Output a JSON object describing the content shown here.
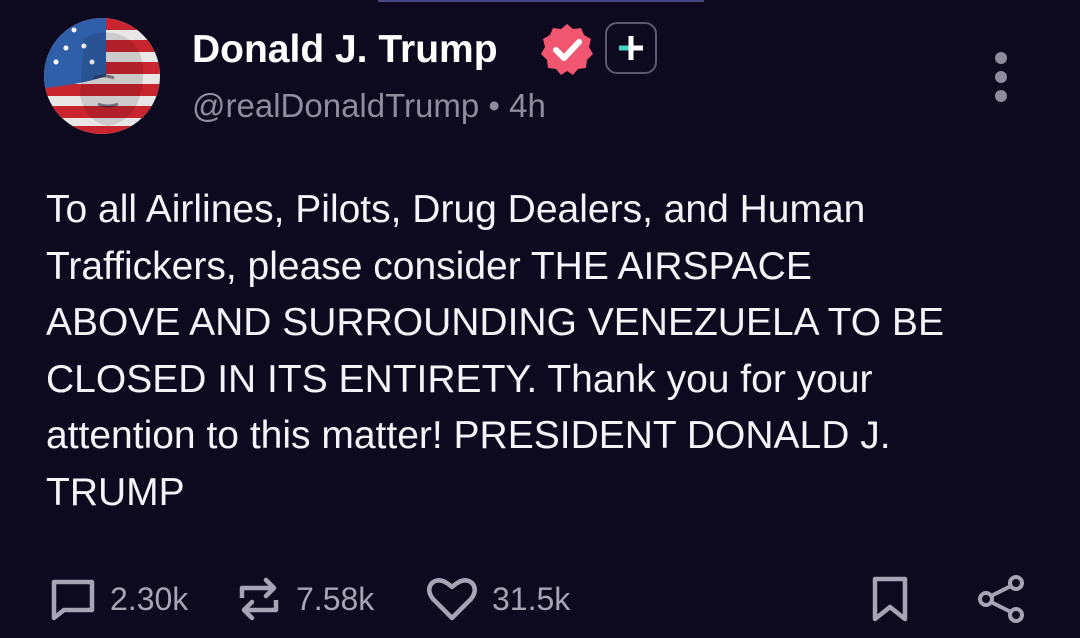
{
  "author": {
    "display_name": "Donald J. Trump",
    "handle": "@realDonaldTrump",
    "separator": "•",
    "time_ago": "4h",
    "avatar_icon": "flag-portrait-avatar",
    "verified_icon": "verified-badge-icon",
    "plus_icon": "plus-badge-icon"
  },
  "post": {
    "lines": [
      "To all Airlines, Pilots, Drug Dealers, and Human",
      "Traffickers, please consider THE AIRSPACE",
      "ABOVE AND SURROUNDING VENEZUELA TO BE",
      "CLOSED IN ITS ENTIRETY. Thank you for your",
      "attention to this matter! PRESIDENT DONALD J.",
      "TRUMP"
    ]
  },
  "actions": {
    "reply_count": "2.30k",
    "repost_count": "7.58k",
    "like_count": "31.5k"
  },
  "colors": {
    "background": "#0d0a1f",
    "text": "#f4f3f8",
    "muted": "#8f8c9e",
    "verified": "#f0566f",
    "plus_accent": "#46d4c2"
  }
}
